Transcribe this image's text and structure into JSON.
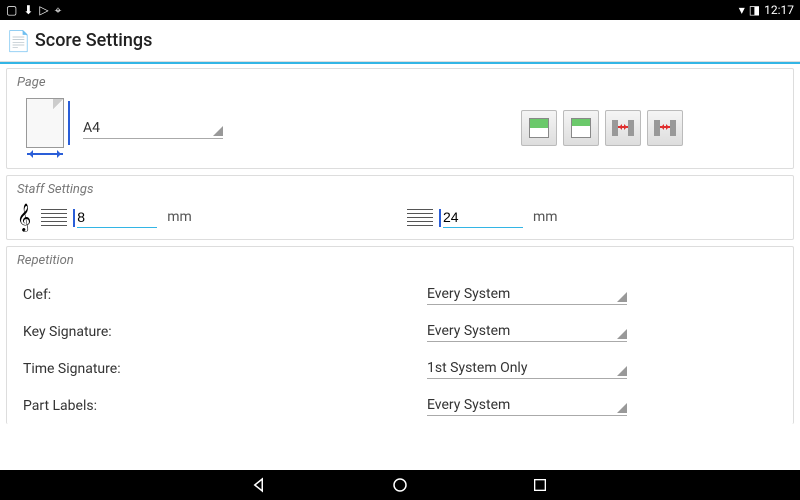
{
  "status": {
    "time": "12:17"
  },
  "appbar": {
    "title": "Score Settings"
  },
  "sections": {
    "page": {
      "title": "Page",
      "size_value": "A4"
    },
    "staff": {
      "title": "Staff Settings",
      "height_value": "8",
      "height_unit": "mm",
      "spacing_value": "24",
      "spacing_unit": "mm"
    },
    "repetition": {
      "title": "Repetition",
      "rows": {
        "clef": {
          "label": "Clef:",
          "value": "Every System"
        },
        "key": {
          "label": "Key Signature:",
          "value": "Every System"
        },
        "time": {
          "label": "Time Signature:",
          "value": "1st System Only"
        },
        "parts": {
          "label": "Part Labels:",
          "value": "Every System"
        }
      }
    }
  }
}
